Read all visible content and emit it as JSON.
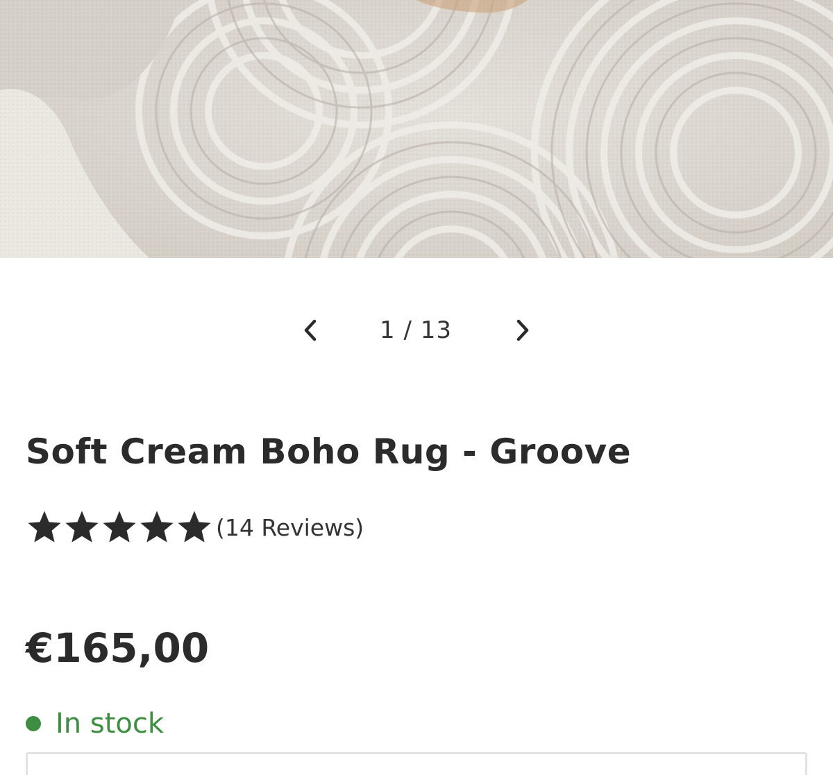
{
  "gallery": {
    "image_alt": "Soft cream rug with curved groove pattern",
    "current": "1",
    "separator": "/",
    "total": "13",
    "counter_text": "1 / 13"
  },
  "product": {
    "title": "Soft Cream Boho Rug - Groove",
    "rating": 5,
    "rating_max": 5,
    "reviews_label": "(14 Reviews)",
    "price": "€165,00",
    "stock_label": "In stock"
  },
  "colors": {
    "stock_green": "#3e8e41",
    "text_dark": "#2b2b2b",
    "star": "#2b2b2b"
  },
  "icons": {
    "prev": "chevron-left-icon",
    "next": "chevron-right-icon",
    "star": "star-icon",
    "stock": "status-dot-icon"
  }
}
